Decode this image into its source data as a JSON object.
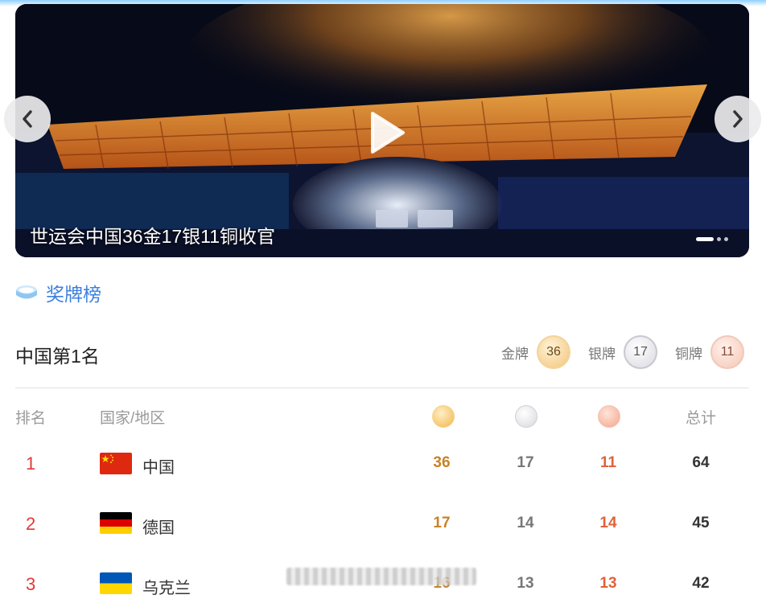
{
  "banner": {
    "caption": "世运会中国36金17银11铜收官",
    "slide_count": 3,
    "active_slide": 1
  },
  "section": {
    "title": "奖牌榜"
  },
  "summary": {
    "rank_text": "中国第1名",
    "gold_label": "金牌",
    "gold": "36",
    "silver_label": "银牌",
    "silver": "17",
    "bronze_label": "铜牌",
    "bronze": "11"
  },
  "table": {
    "headers": {
      "rank": "排名",
      "country": "国家/地区",
      "gold_icon": "gold-medal-icon",
      "silver_icon": "silver-medal-icon",
      "bronze_icon": "bronze-medal-icon",
      "total": "总计"
    },
    "rows": [
      {
        "rank": "1",
        "country": "中国",
        "flag": "china-flag-icon",
        "gold": "36",
        "silver": "17",
        "bronze": "11",
        "total": "64"
      },
      {
        "rank": "2",
        "country": "德国",
        "flag": "germany-flag-icon",
        "gold": "17",
        "silver": "14",
        "bronze": "14",
        "total": "45"
      },
      {
        "rank": "3",
        "country": "乌克兰",
        "flag": "ukraine-flag-icon",
        "gold": "16",
        "silver": "13",
        "bronze": "13",
        "total": "42"
      }
    ]
  },
  "colors": {
    "accent_blue": "#3a7fe0",
    "rank_red": "#e23a3a",
    "gold_text": "#c8822a",
    "bronze_text": "#e0623a"
  }
}
